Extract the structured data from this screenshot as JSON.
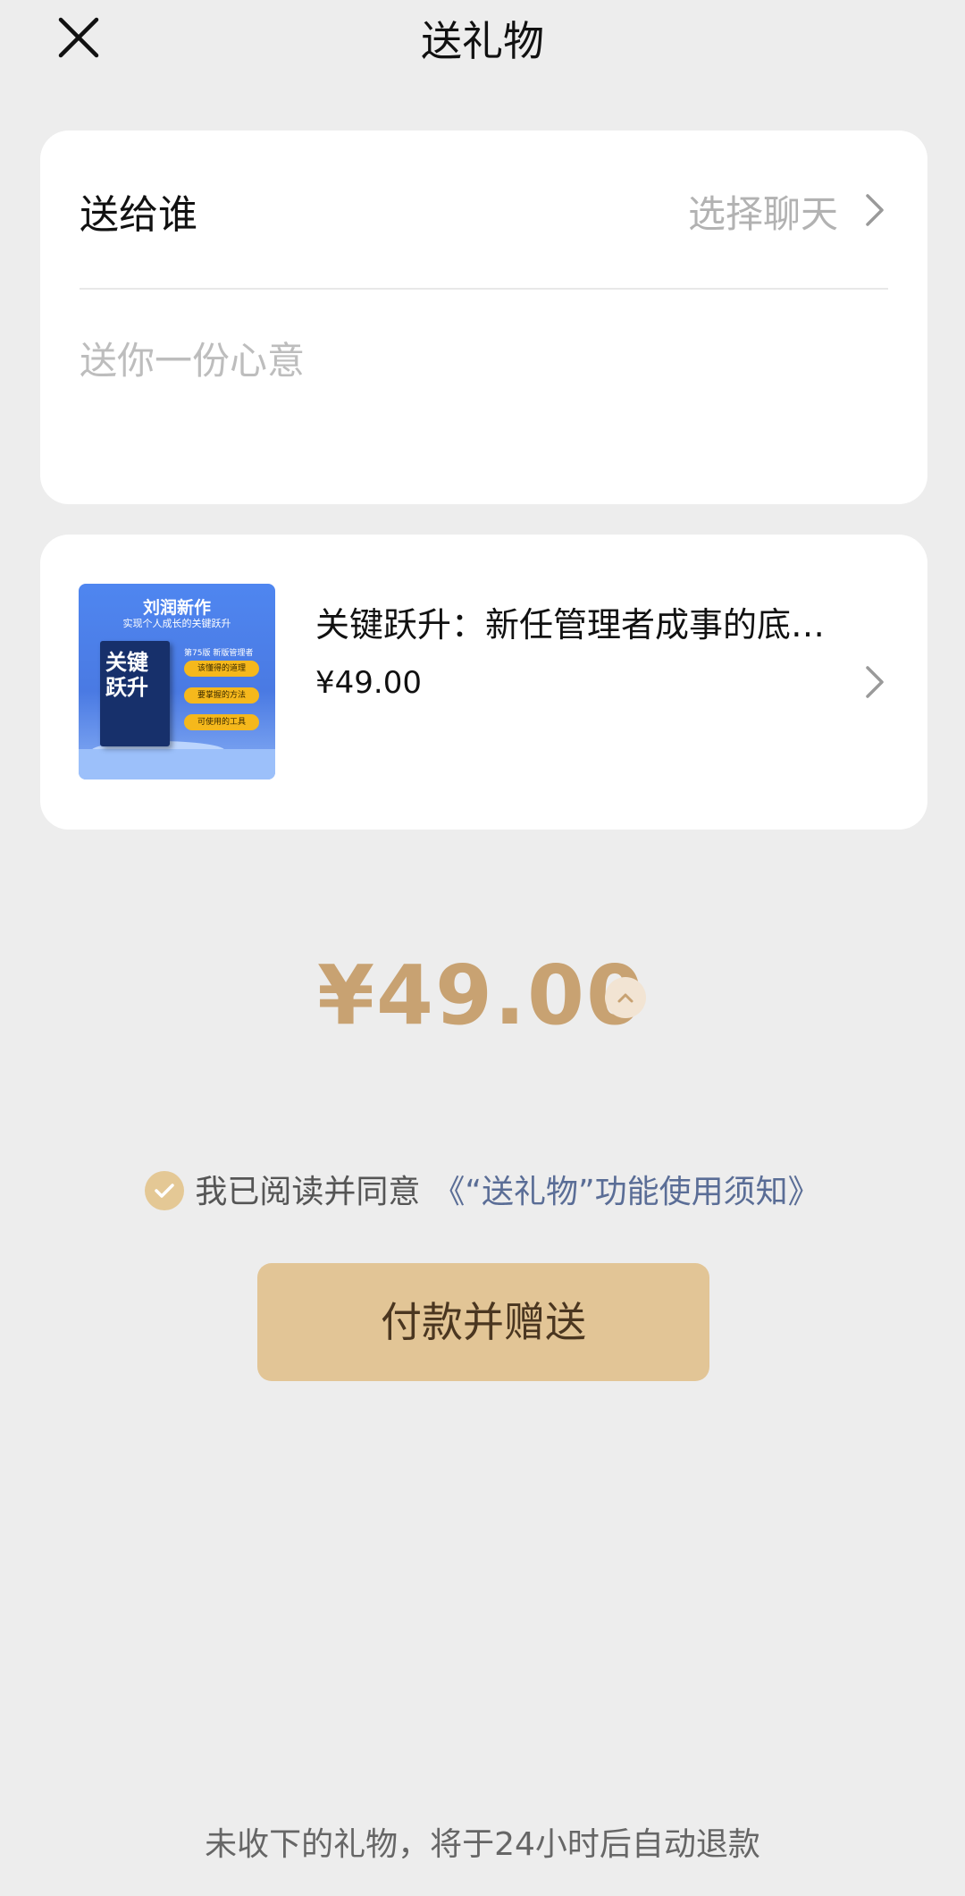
{
  "header": {
    "title": "送礼物",
    "close_icon": "close-icon"
  },
  "recipient": {
    "label": "送给谁",
    "value": "选择聊天",
    "chevron_icon": "chevron-right-icon",
    "message_placeholder": "送你一份心意"
  },
  "product": {
    "title": "关键跃升：新任管理者成事的底…",
    "price": "¥49.00",
    "chevron_icon": "chevron-right-icon",
    "cover": {
      "author": "刘润新作",
      "subtitle": "实现个人成长的关键跃升",
      "book_title": "关键跃升",
      "tag_header": "第75版 新版管理者",
      "tags": [
        "该懂得的道理",
        "要掌握的方法",
        "可使用的工具"
      ]
    }
  },
  "price_total": {
    "amount": "¥49.00",
    "toggle_icon": "chevron-up-icon"
  },
  "agreement": {
    "checked": true,
    "text": "我已阅读并同意",
    "link": "《“送礼物”功能使用须知》",
    "check_icon": "check-icon"
  },
  "pay_button": {
    "label": "付款并赠送"
  },
  "footer": {
    "note": "未收下的礼物，将于24小时后自动退款"
  },
  "colors": {
    "background": "#ededed",
    "card": "#ffffff",
    "price": "#c8a272",
    "button": "#e2c596",
    "link": "#5a6d96",
    "check": "#e4c895"
  }
}
